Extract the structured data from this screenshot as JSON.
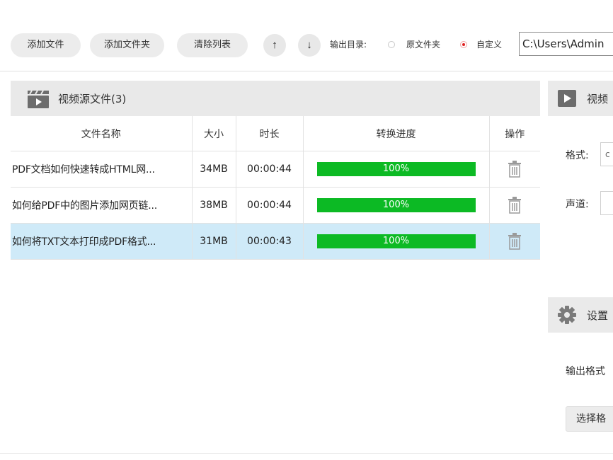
{
  "toolbar": {
    "add_file": "添加文件",
    "add_folder": "添加文件夹",
    "clear_list": "清除列表",
    "move_up": "↑",
    "move_down": "↓",
    "output_dir_label": "输出目录:",
    "option_source_folder": "原文件夹",
    "option_custom": "自定义",
    "output_path": "C:\\Users\\Admin",
    "selected_option": "自定义"
  },
  "source_panel": {
    "title": "视频源文件(3)",
    "icon": "clapperboard-icon",
    "columns": [
      "文件名称",
      "大小",
      "时长",
      "转换进度",
      "操作"
    ],
    "rows": [
      {
        "name": "PDF文档如何快速转成HTML网...",
        "size": "34MB",
        "duration": "00:00:44",
        "progress": "100%",
        "selected": false
      },
      {
        "name": "如何给PDF中的图片添加网页链...",
        "size": "38MB",
        "duration": "00:00:44",
        "progress": "100%",
        "selected": false
      },
      {
        "name": "如何将TXT文本打印成PDF格式...",
        "size": "31MB",
        "duration": "00:00:43",
        "progress": "100%",
        "selected": true
      }
    ]
  },
  "right_panel": {
    "video_section_title": "视频",
    "video_icon": "play-icon",
    "format_label": "格式:",
    "format_value": "c",
    "channel_label": "声道:",
    "settings_title": "设置",
    "settings_icon": "gear-icon",
    "output_format_label": "输出格式",
    "select_format_button": "选择格"
  },
  "colors": {
    "progress_fill": "#0cba24",
    "selected_row": "#cfeaf8",
    "radio_checked": "#e02020",
    "panel_header": "#e9e9e9"
  }
}
